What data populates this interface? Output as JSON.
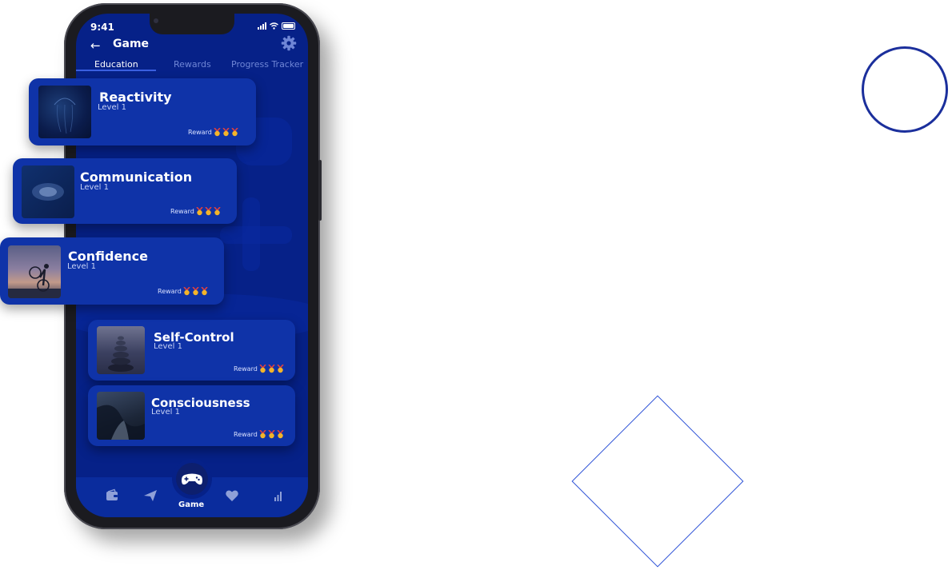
{
  "status_bar": {
    "time": "9:41"
  },
  "header": {
    "title": "Game"
  },
  "tabs": [
    {
      "label": "Education",
      "active": true
    },
    {
      "label": "Rewards",
      "active": false
    },
    {
      "label": "Progress Tracker",
      "active": false
    }
  ],
  "cards": [
    {
      "title": "Reactivity",
      "level": "Level 1",
      "reward_label": "Reward",
      "medals": 3
    },
    {
      "title": "Communication",
      "level": "Level 1",
      "reward_label": "Reward",
      "medals": 3
    },
    {
      "title": "Confidence",
      "level": "Level 1",
      "reward_label": "Reward",
      "medals": 3
    },
    {
      "title": "Self-Control",
      "level": "Level 1",
      "reward_label": "Reward",
      "medals": 3
    },
    {
      "title": "Consciousness",
      "level": "Level 1",
      "reward_label": "Reward",
      "medals": 3
    }
  ],
  "bottom_nav": {
    "items": [
      {
        "icon": "wallet-icon"
      },
      {
        "icon": "send-icon"
      },
      {
        "icon": "gamepad-icon",
        "label": "Game",
        "active": true
      },
      {
        "icon": "heart-icon"
      },
      {
        "icon": "bar-chart-icon"
      }
    ]
  },
  "colors": {
    "screen_bg": "#062188",
    "card_bg": "#0f33a8",
    "accent_circle": "#1b2f9c",
    "accent_diamond": "#2a4fd6"
  }
}
